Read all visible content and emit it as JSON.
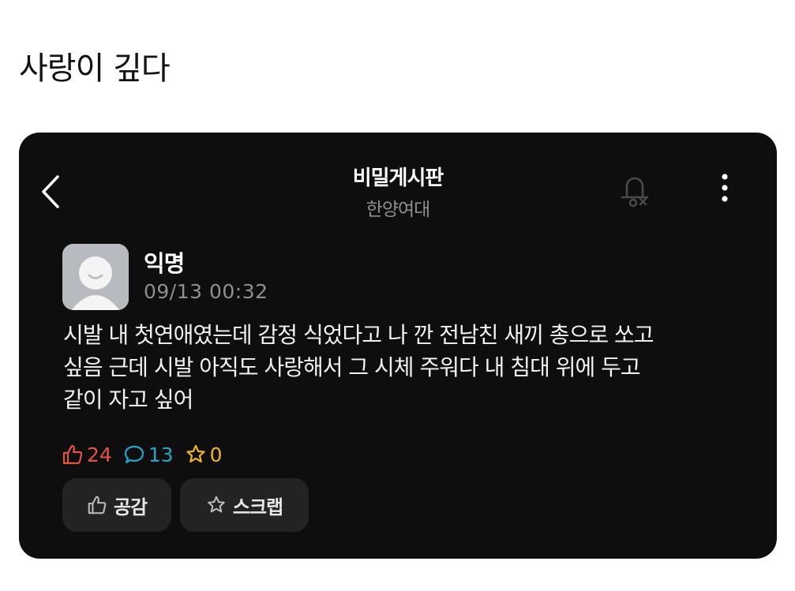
{
  "page": {
    "title": "사랑이 깊다"
  },
  "header": {
    "board_title": "비밀게시판",
    "board_subtitle": "한양여대",
    "icons": [
      "chevron-left-icon",
      "bell-off-icon",
      "more-vertical-icon"
    ]
  },
  "post": {
    "author": "익명",
    "time": "09/13 00:32",
    "body": "시발 내 첫연애였는데 감정 식었다고 나 깐 전남친 새끼 총으로 쏘고\n싶음 근데 시발 아직도 사랑해서 그 시체 주워다 내 침대 위에 두고\n같이 자고 싶어"
  },
  "stats": {
    "likes": "24",
    "comments": "13",
    "scraps": "0"
  },
  "actions": {
    "empathy_label": "공감",
    "scrap_label": "스크랩"
  },
  "colors": {
    "card_background": "#0e0e0f",
    "like": "#e5533d",
    "comment": "#1fa7c9",
    "scrap": "#f2b51b",
    "button_background": "#232325"
  }
}
